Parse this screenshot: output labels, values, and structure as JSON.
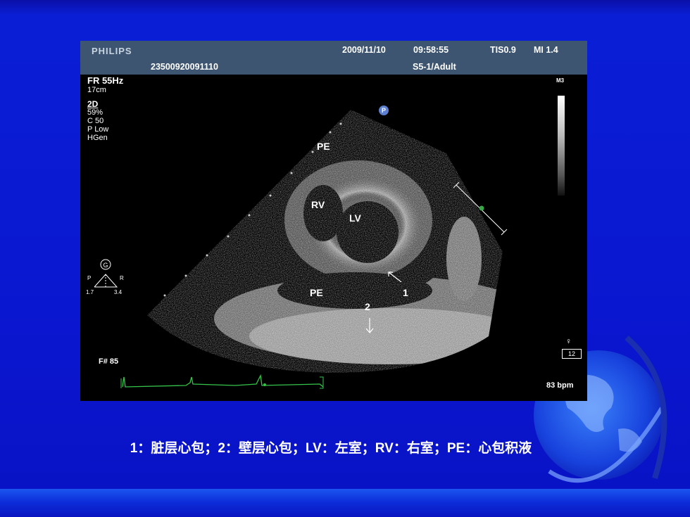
{
  "ultrasound": {
    "brand": "PHILIPS",
    "date": "2009/11/10",
    "time": "09:58:55",
    "tis": "TIS0.9",
    "mi": "MI 1.4",
    "patient_id": "23500920091110",
    "probe": "S5-1/Adult",
    "frame_rate": "FR 55Hz",
    "depth": "17cm",
    "mode": "2D",
    "gain": "59%",
    "compress": "C 50",
    "power": "P Low",
    "harmonic": "HGen",
    "map": "M3",
    "frame_number": "F# 85",
    "heart_rate": "83 bpm",
    "depth_marker": "12",
    "p_badge": "P",
    "orientation": {
      "g": "G",
      "p": "P",
      "r": "R",
      "left_value": "1.7",
      "right_value": "3.4"
    },
    "labels": {
      "pe_top": "PE",
      "rv": "RV",
      "lv": "LV",
      "pe_bottom": "PE",
      "marker_1": "1",
      "marker_2": "2"
    }
  },
  "caption": "1：脏层心包；2：壁层心包；LV：左室；RV：右室；PE：心包积液",
  "colors": {
    "background": "#0a1fd6",
    "header": "#3d5570",
    "ecg": "#35c44a"
  }
}
